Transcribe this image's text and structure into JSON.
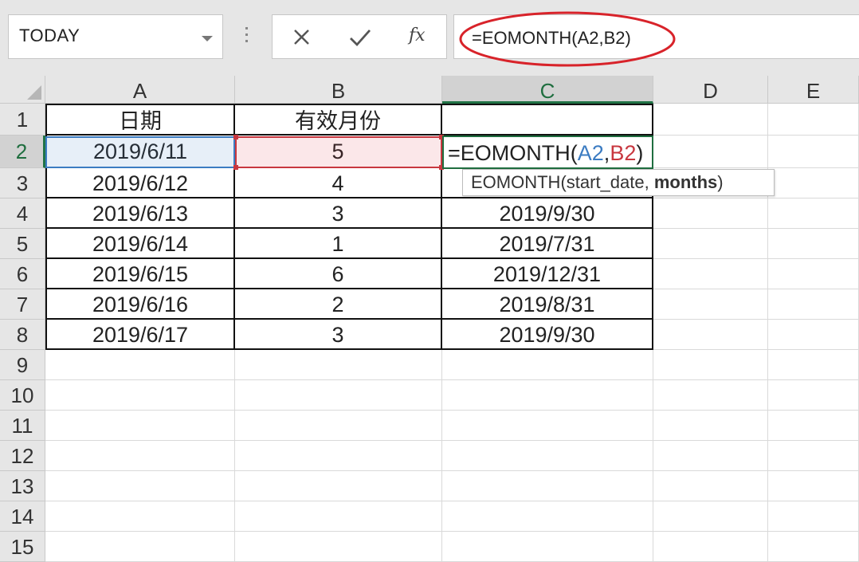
{
  "name_box": {
    "value": "TODAY"
  },
  "formula_bar": {
    "cancel_icon": "x-icon",
    "enter_icon": "check-icon",
    "function_label": "fx",
    "formula": "=EOMONTH(A2,B2)"
  },
  "columns": [
    "A",
    "B",
    "C",
    "D",
    "E"
  ],
  "rows": [
    "1",
    "2",
    "3",
    "4",
    "5",
    "6",
    "7",
    "8",
    "9",
    "10",
    "11",
    "12",
    "13",
    "14",
    "15"
  ],
  "table": {
    "header": [
      "日期",
      "有效月份",
      ""
    ],
    "data": [
      [
        "2019/6/11",
        "5",
        ""
      ],
      [
        "2019/6/12",
        "4",
        ""
      ],
      [
        "2019/6/13",
        "3",
        "2019/9/30"
      ],
      [
        "2019/6/14",
        "1",
        "2019/7/31"
      ],
      [
        "2019/6/15",
        "6",
        "2019/12/31"
      ],
      [
        "2019/6/16",
        "2",
        "2019/8/31"
      ],
      [
        "2019/6/17",
        "3",
        "2019/9/30"
      ]
    ]
  },
  "editing_cell": {
    "prefix": "=EOMONTH(",
    "ref1": "A2",
    "sep": ",",
    "ref2": "B2",
    "suffix": ")"
  },
  "tooltip": {
    "prefix": "EOMONTH(start_date, ",
    "bold": "months",
    "suffix": ")"
  },
  "colors": {
    "accent_green": "#217346",
    "ref_blue": "#3c7cc2",
    "ref_red": "#c8373f",
    "annotation_red": "#d8232a"
  }
}
